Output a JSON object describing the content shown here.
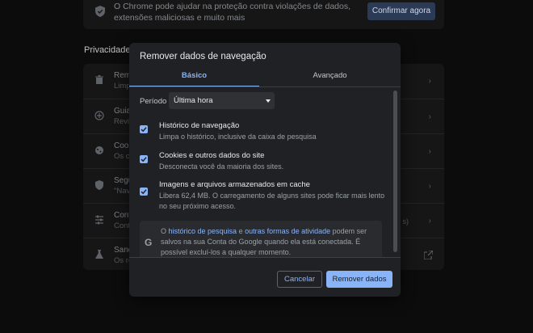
{
  "background": {
    "top_card": {
      "message": "O Chrome pode ajudar na proteção contra violações de dados, extensões maliciosas e muito mais",
      "confirm_label": "Confirmar agora"
    },
    "section_title": "Privacidade e",
    "rows": [
      {
        "title": "Remo",
        "subtitle": "Limpa",
        "icon": "trash-icon"
      },
      {
        "title": "Guia",
        "subtitle": "Revis",
        "icon": "add-circle-icon"
      },
      {
        "title": "Cook",
        "subtitle": "Os c",
        "icon": "cookie-icon"
      },
      {
        "title": "Segu",
        "subtitle": "\"Nav",
        "icon": "shield-icon"
      },
      {
        "title": "Conf",
        "subtitle": "Contr",
        "icon": "tune-icon",
        "extra": "s)"
      },
      {
        "title": "Sand",
        "subtitle": "Os re",
        "icon": "flask-icon"
      }
    ]
  },
  "dialog": {
    "title": "Remover dados de navegação",
    "tabs": {
      "basic": "Básico",
      "advanced": "Avançado"
    },
    "period": {
      "label": "Período",
      "selected": "Última hora"
    },
    "options": [
      {
        "title": "Histórico de navegação",
        "description": "Limpa o histórico, inclusive da caixa de pesquisa",
        "checked": true
      },
      {
        "title": "Cookies e outros dados do site",
        "description": "Desconecta você da maioria dos sites.",
        "checked": true
      },
      {
        "title": "Imagens e arquivos armazenados em cache",
        "description": "Libera 62,4 MB. O carregamento de alguns sites pode ficar mais lento no seu próximo acesso.",
        "checked": true
      }
    ],
    "google_notice": {
      "prefix": "O ",
      "link1": "histórico de pesquisa",
      "middle": " e ",
      "link2": "outras formas de atividade",
      "suffix": " podem ser salvos na sua Conta do Google quando ela está conectada. É possível excluí-los a qualquer momento."
    },
    "buttons": {
      "cancel": "Cancelar",
      "remove": "Remover dados"
    }
  },
  "colors": {
    "accent": "#8ab4f8",
    "dialog_bg": "#202124",
    "backdrop": "#0c0c0c"
  }
}
